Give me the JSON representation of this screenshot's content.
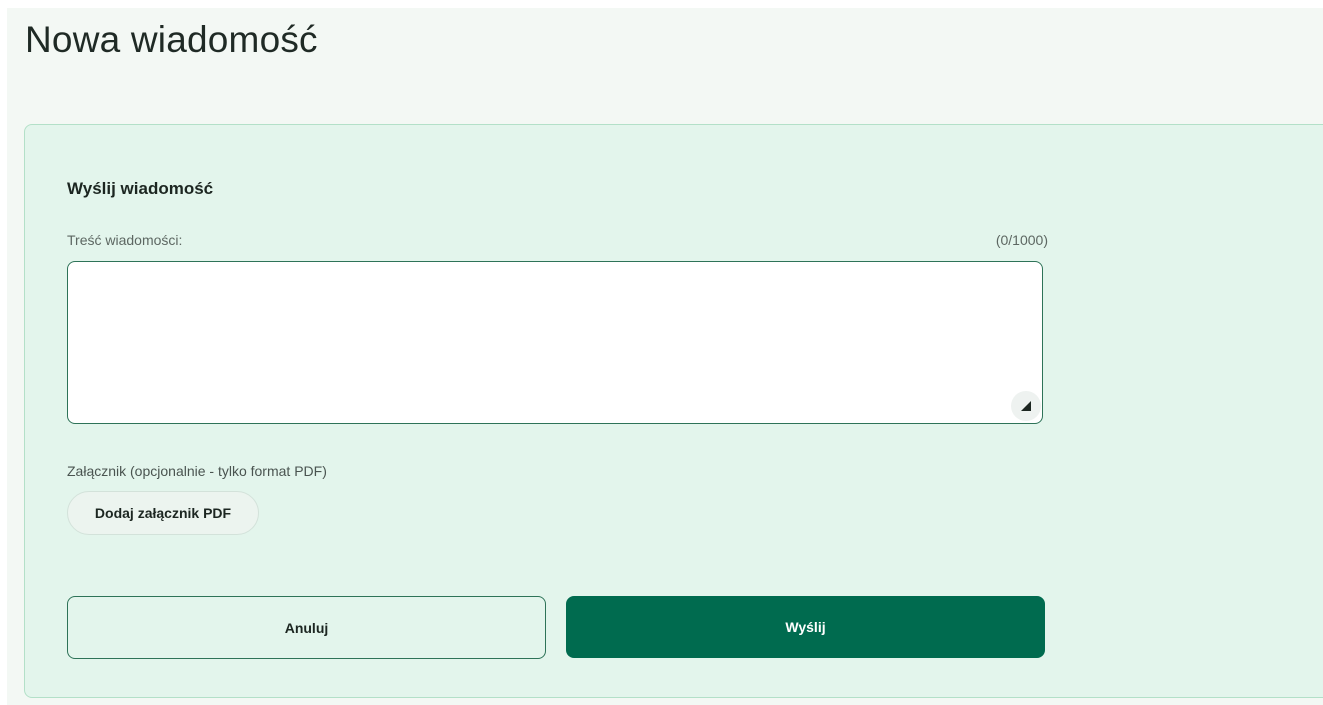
{
  "page": {
    "title": "Nowa wiadomość"
  },
  "form": {
    "heading": "Wyślij wiadomość",
    "message": {
      "label": "Treść wiadomości:",
      "counter": "(0/1000)",
      "value": "",
      "placeholder": ""
    },
    "attachment": {
      "label": "Załącznik (opcjonalnie - tylko format PDF)",
      "button_label": "Dodaj załącznik PDF"
    },
    "actions": {
      "cancel_label": "Anuluj",
      "send_label": "Wyślij"
    }
  },
  "icons": {
    "resize_handle": "resize-corner-icon"
  },
  "colors": {
    "primary": "#006b4f",
    "border_accent": "#2e7358",
    "card_background": "#e3f5ec",
    "page_background": "#f3f8f4"
  }
}
